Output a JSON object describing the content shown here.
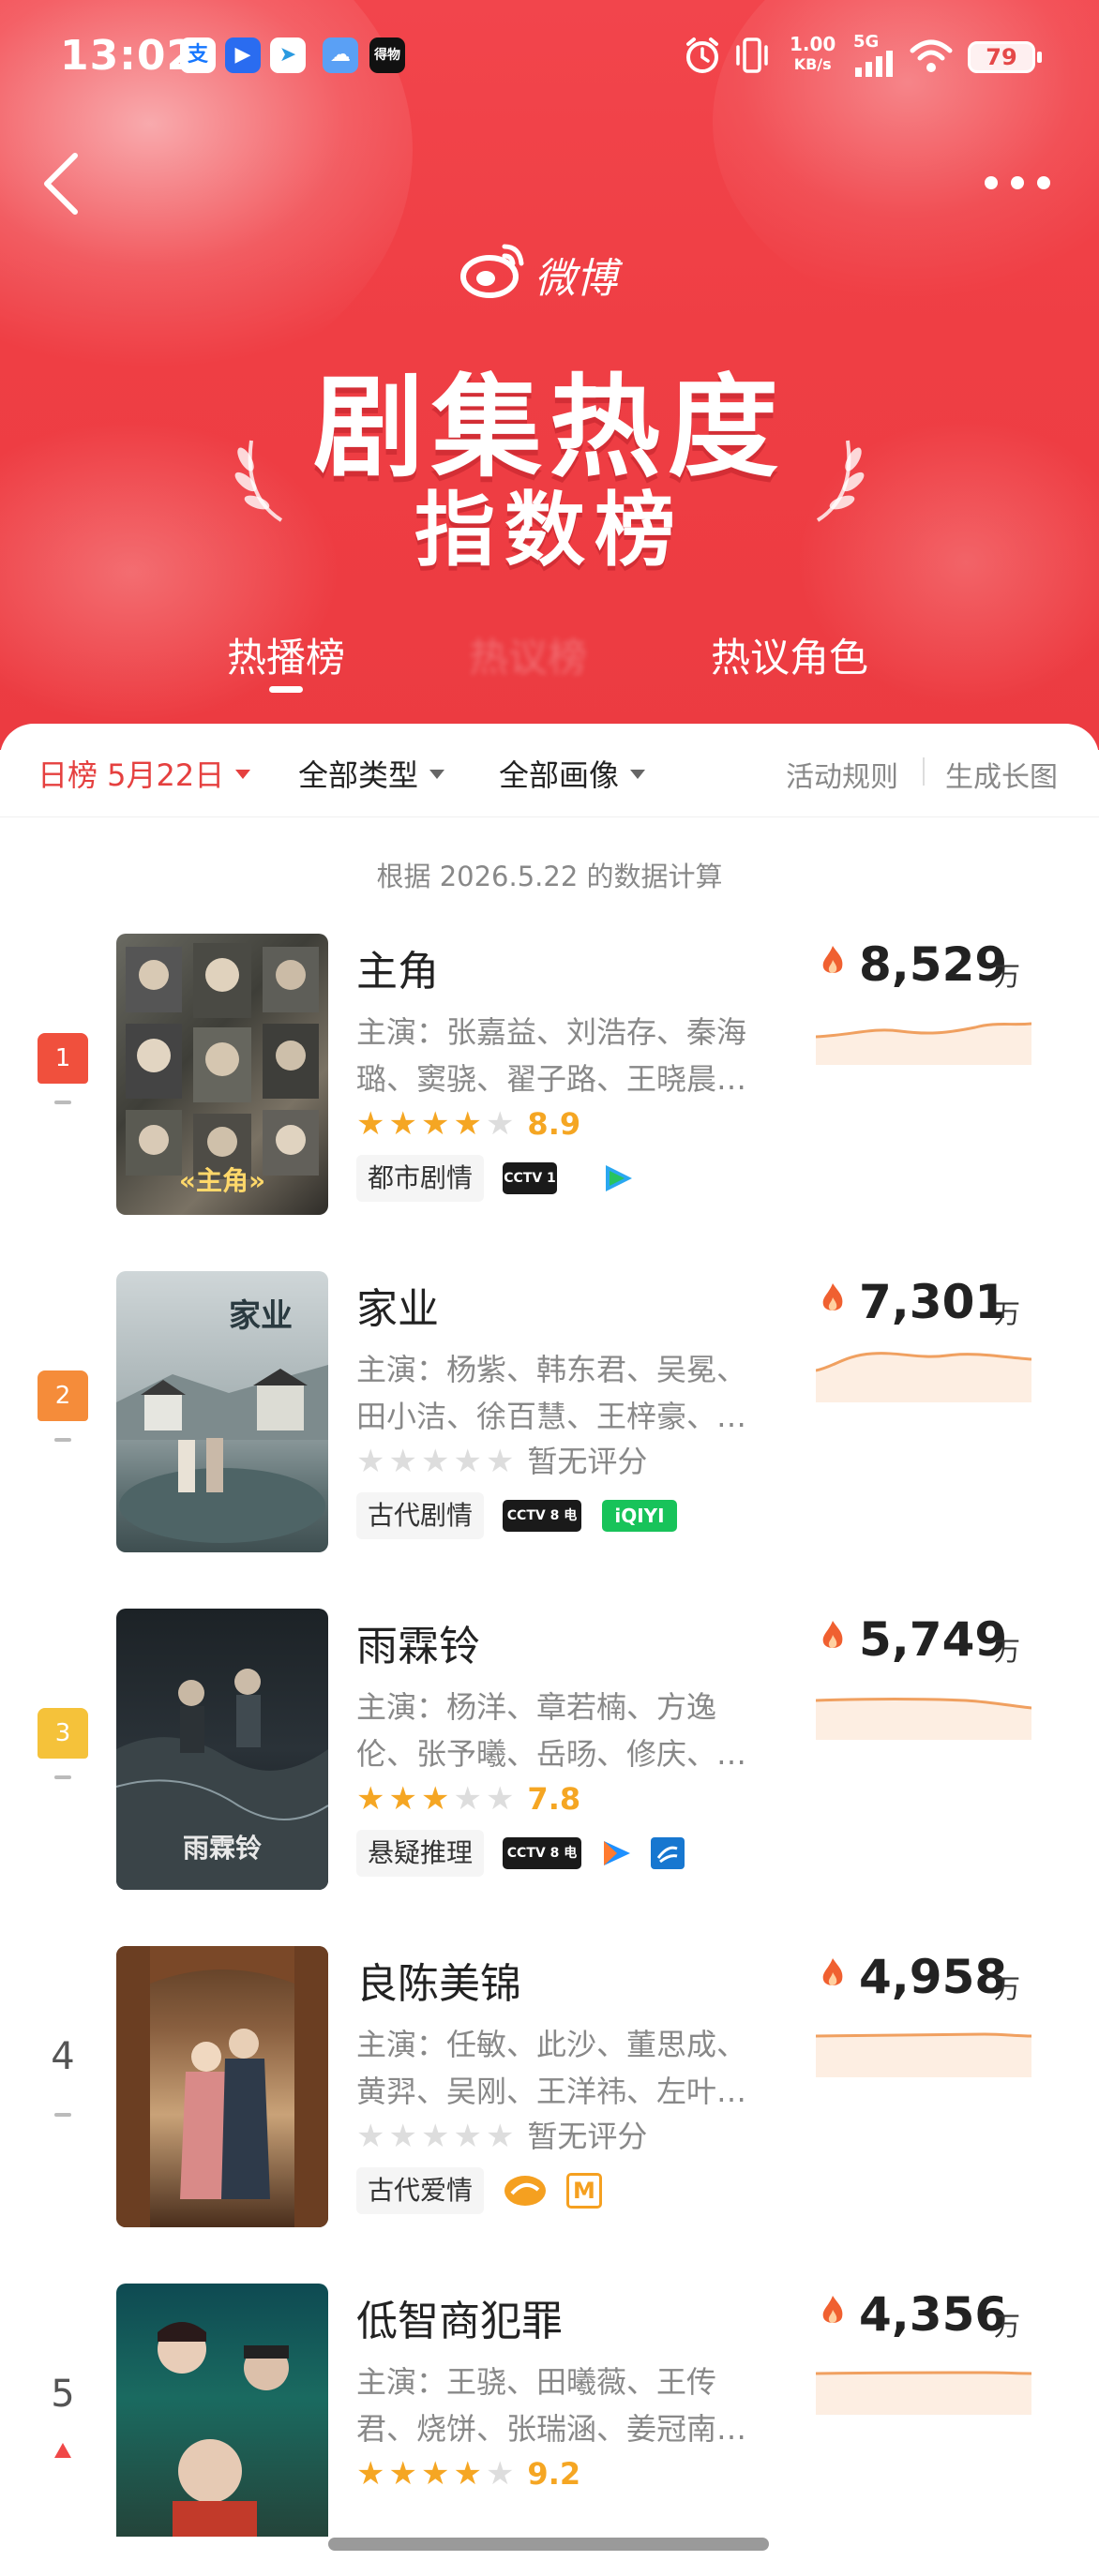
{
  "status_bar": {
    "time": "13:02",
    "app_icons": [
      "支",
      "▶",
      "➤",
      "☁",
      "得物"
    ],
    "speed_value": "1.00",
    "speed_unit": "KB/s",
    "network": "5G",
    "battery": "79"
  },
  "header": {
    "brand": "微博",
    "title_line1": "剧集热度",
    "title_line2": "指数榜",
    "tabs": [
      {
        "label": "热播榜",
        "active": true
      },
      {
        "label": "热议榜",
        "active": false,
        "blurred": true
      },
      {
        "label": "热议角色",
        "active": false
      }
    ]
  },
  "filters": {
    "date": "日榜 5月22日",
    "type": "全部类型",
    "audience": "全部画像",
    "rules_link": "活动规则",
    "long_image_link": "生成长图"
  },
  "calc_note": "根据 2026.5.22 的数据计算",
  "colors": {
    "brand_red": "#ef3e44",
    "star_orange": "#f5a623",
    "star_gray": "#dddddd",
    "rank1": "#f0503d",
    "rank2": "#f58c3a",
    "rank3": "#f5c23a"
  },
  "items": [
    {
      "rank": "1",
      "title": "主角",
      "cast": "主演：张嘉益、刘浩存、秦海璐、窦骁、翟子路、王晓晨…",
      "rating_stars": 4,
      "score": "8.9",
      "genre": "都市剧情",
      "platforms": [
        "CCTV 1 综合",
        "腾讯视频"
      ],
      "heat": "8,529",
      "heat_unit": "万",
      "poster_caption": "«主角»",
      "trend": "flat"
    },
    {
      "rank": "2",
      "title": "家业",
      "cast": "主演：杨紫、韩东君、吴冕、田小洁、徐百慧、王梓豪、…",
      "rating_stars": 0,
      "score": "暂无评分",
      "genre": "古代剧情",
      "platforms": [
        "CCTV 8 电视剧",
        "iQIYI"
      ],
      "heat": "7,301",
      "heat_unit": "万",
      "poster_caption": "家业",
      "trend": "flat"
    },
    {
      "rank": "3",
      "title": "雨霖铃",
      "cast": "主演：杨洋、章若楠、方逸伦、张予曦、岳旸、修庆、…",
      "rating_stars": 3,
      "score": "7.8",
      "genre": "悬疑推理",
      "platforms": [
        "CCTV 8 电视剧",
        "优酷",
        "浙江卫视"
      ],
      "heat": "5,749",
      "heat_unit": "万",
      "poster_caption": "雨霖铃",
      "trend": "flat"
    },
    {
      "rank": "4",
      "title": "良陈美锦",
      "cast": "主演：任敏、此沙、董思成、黄羿、吴刚、王洋祎、左叶…",
      "rating_stars": 0,
      "score": "暂无评分",
      "genre": "古代爱情",
      "platforms": [
        "芒果",
        "M"
      ],
      "heat": "4,958",
      "heat_unit": "万",
      "poster_caption": "",
      "trend": "flat"
    },
    {
      "rank": "5",
      "title": "低智商犯罪",
      "cast": "主演：王骁、田曦薇、王传君、烧饼、张瑞涵、姜冠南…",
      "rating_stars": 4,
      "score": "9.2",
      "genre": "",
      "platforms": [],
      "heat": "4,356",
      "heat_unit": "万",
      "poster_caption": "",
      "trend": "up"
    }
  ]
}
